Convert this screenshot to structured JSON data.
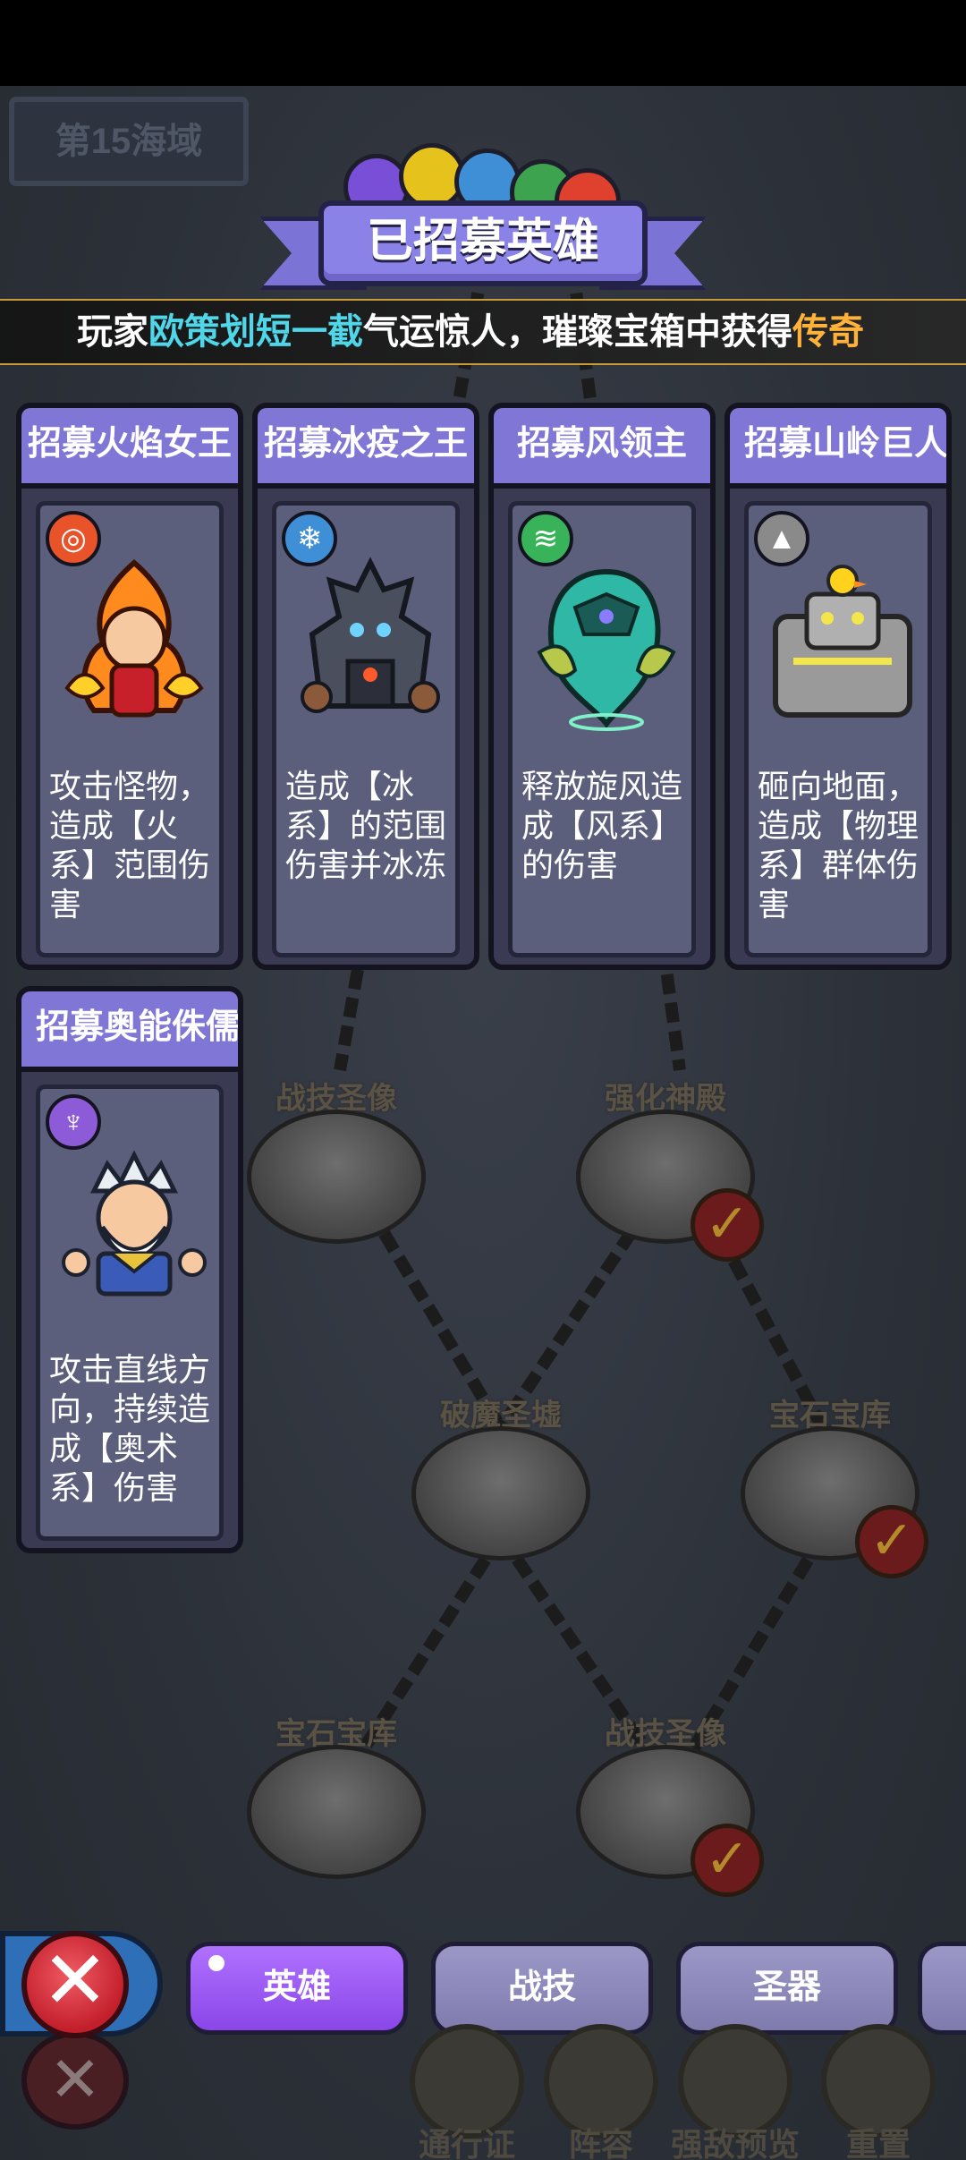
{
  "sea_label": "第15海域",
  "banner_title": "已招募英雄",
  "ticker": {
    "prefix": "玩家",
    "player": "欧策划短一截",
    "middle": "气运惊人，璀璨宝箱中获得",
    "reward": "传奇"
  },
  "map_nodes": [
    {
      "label": "战技圣像",
      "checked": false
    },
    {
      "label": "强化神殿",
      "checked": true
    },
    {
      "label": "破魔圣墟",
      "checked": false
    },
    {
      "label": "宝石宝库",
      "checked": true
    },
    {
      "label": "宝石宝库",
      "checked": false
    },
    {
      "label": "战技圣像",
      "checked": true
    }
  ],
  "heroes": [
    {
      "title": "招募火焰女王",
      "element_icon": "fire-element-icon",
      "element_color": "#e8532a",
      "description": "攻击怪物，造成【火系】范围伤害"
    },
    {
      "title": "招募冰疫之王",
      "element_icon": "ice-element-icon",
      "element_color": "#3f8fd6",
      "description": "造成【冰系】的范围伤害并冰冻"
    },
    {
      "title": "招募风领主",
      "element_icon": "wind-element-icon",
      "element_color": "#38b35a",
      "description": "释放旋风造成【风系】的伤害"
    },
    {
      "title": "招募山岭巨人",
      "element_icon": "rock-element-icon",
      "element_color": "#8a8a8a",
      "description": "砸向地面，造成【物理系】群体伤害"
    },
    {
      "title": "招募奥能侏儒",
      "element_icon": "arcane-element-icon",
      "element_color": "#8d5bd8",
      "description": "攻击直线方向，持续造成【奥术系】伤害"
    }
  ],
  "tabs": [
    {
      "label": "英雄",
      "active": true
    },
    {
      "label": "战技",
      "active": false
    },
    {
      "label": "圣器",
      "active": false
    }
  ],
  "bottom_menu": [
    "通行证",
    "阵容",
    "强敌预览",
    "重置"
  ],
  "gem_colors": [
    "#7a4fd8",
    "#e6c21c",
    "#3f8fd6",
    "#3ea34f",
    "#e0402e"
  ]
}
